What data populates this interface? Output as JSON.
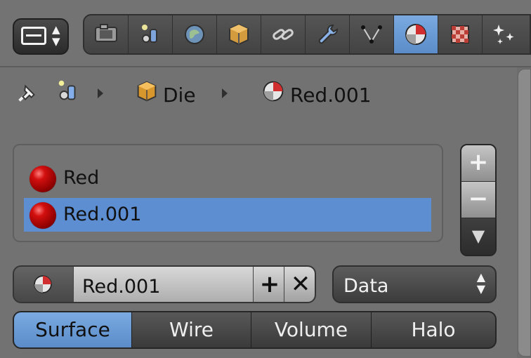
{
  "header": {
    "selector_icon": "editor-type-icon",
    "tabs": [
      {
        "name": "render",
        "icon": "camera-icon",
        "active": false
      },
      {
        "name": "scene",
        "icon": "scene-icon",
        "active": false
      },
      {
        "name": "world",
        "icon": "world-icon",
        "active": false
      },
      {
        "name": "object",
        "icon": "cube-icon",
        "active": false
      },
      {
        "name": "constraints",
        "icon": "link-icon",
        "active": false
      },
      {
        "name": "modifiers",
        "icon": "wrench-icon",
        "active": false
      },
      {
        "name": "data",
        "icon": "vertex-icon",
        "active": false
      },
      {
        "name": "material",
        "icon": "material-icon",
        "active": true
      },
      {
        "name": "texture",
        "icon": "checker-icon",
        "active": false
      },
      {
        "name": "particles",
        "icon": "sparkles-icon",
        "active": false
      }
    ]
  },
  "breadcrumb": {
    "items": [
      {
        "label": "",
        "icon": "pin-icon"
      },
      {
        "label": "",
        "icon": "scene-icon"
      },
      {
        "label": "Die",
        "icon": "cube-icon"
      },
      {
        "label": "Red.001",
        "icon": "material-icon"
      }
    ]
  },
  "materials": {
    "items": [
      {
        "label": "Red",
        "selected": false
      },
      {
        "label": "Red.001",
        "selected": true
      }
    ],
    "side_buttons": [
      {
        "label": "+",
        "icon": "add-icon"
      },
      {
        "label": "−",
        "icon": "remove-icon"
      },
      {
        "label": "▼",
        "icon": "dropdown-arrow-icon"
      }
    ]
  },
  "material_row": {
    "name": "Red.001",
    "add_label": "+",
    "remove_label": "✕",
    "link_value": "Data"
  },
  "sections": [
    {
      "label": "Surface",
      "active": true
    },
    {
      "label": "Wire",
      "active": false
    },
    {
      "label": "Volume",
      "active": false
    },
    {
      "label": "Halo",
      "active": false
    }
  ],
  "colors": {
    "accent": "#5b8cc9",
    "panel": "#727272",
    "dark_button": "#3c3c3c",
    "material_red": "#c40f0f"
  }
}
